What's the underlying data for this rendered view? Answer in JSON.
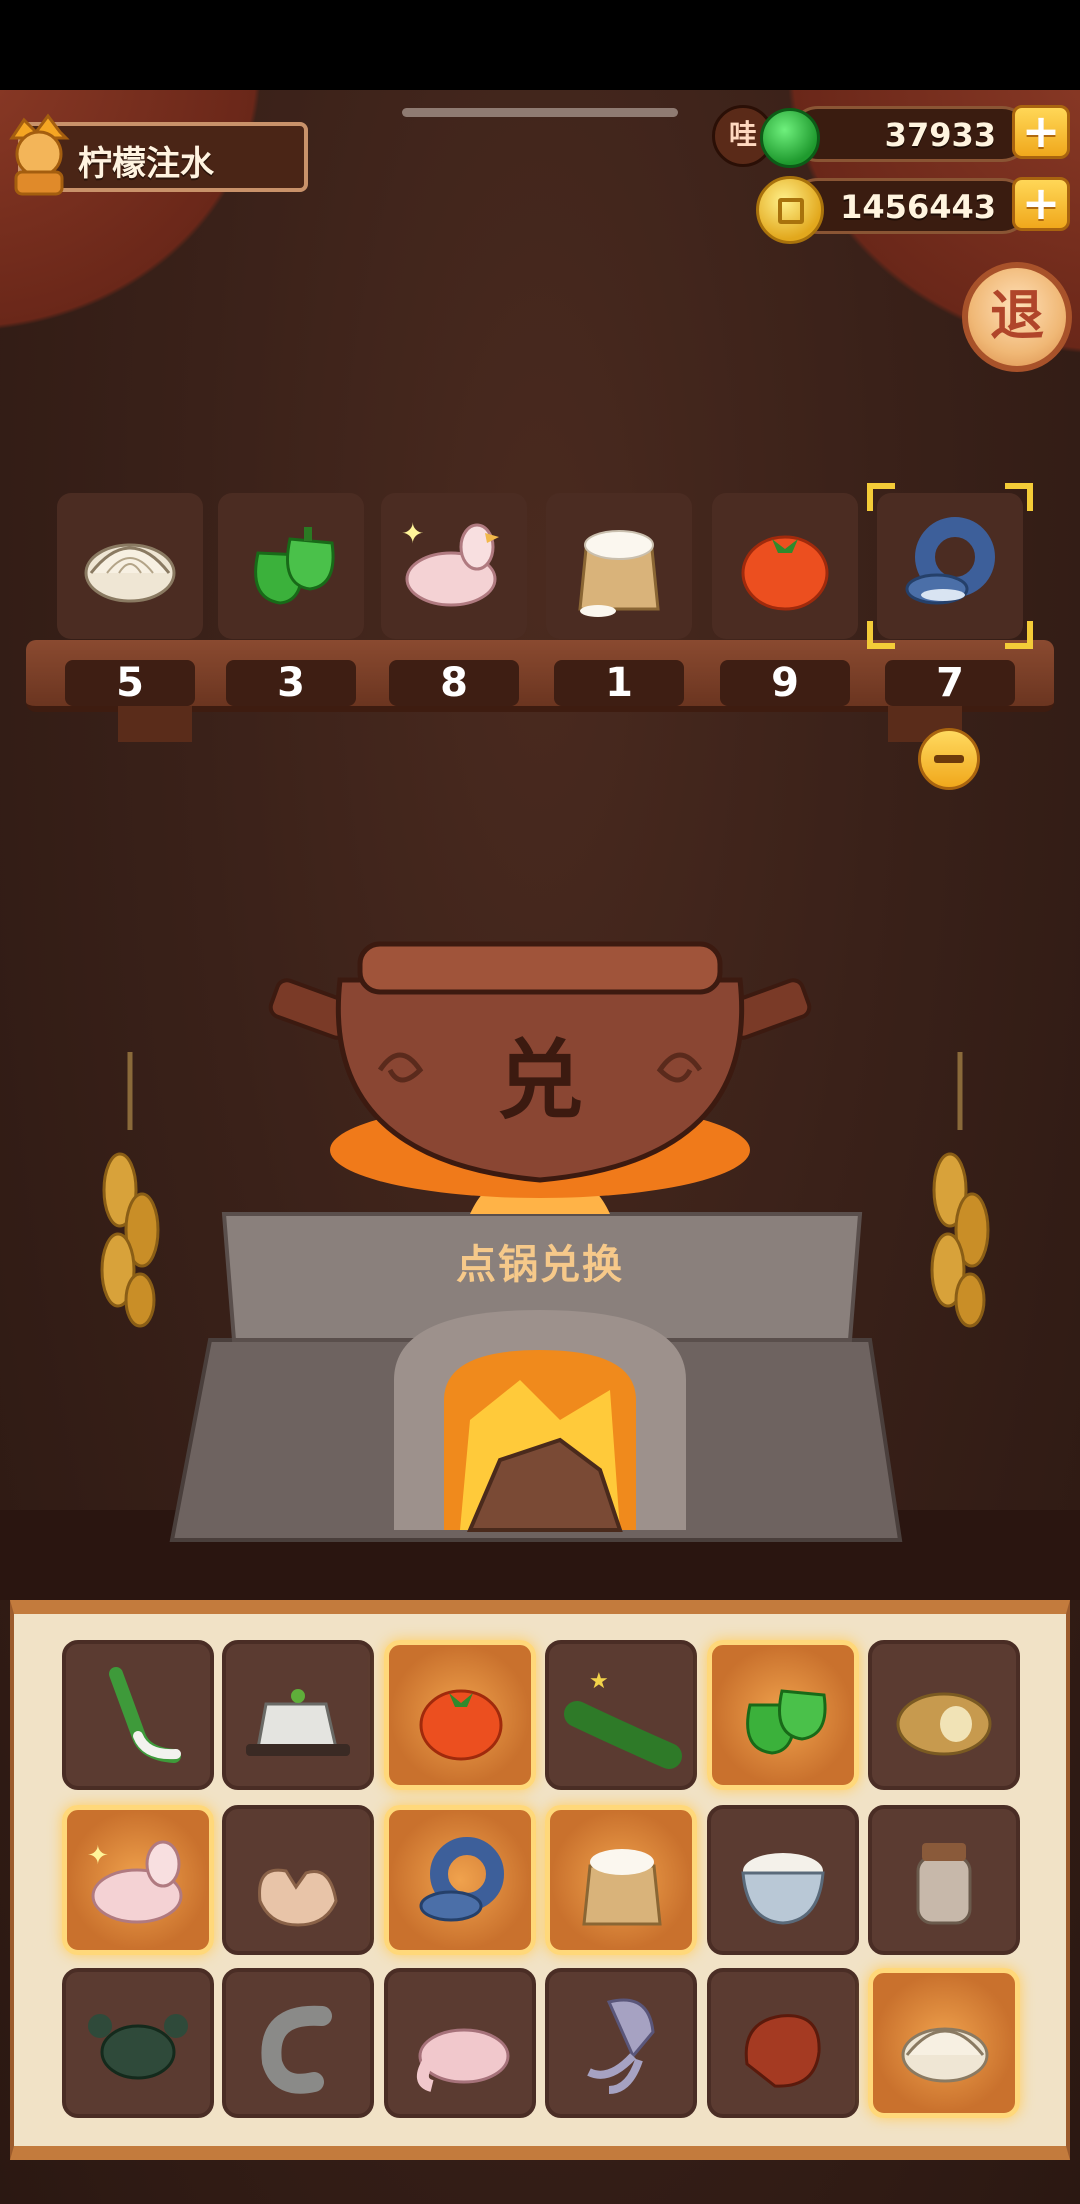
{
  "player": {
    "name": "柠檬注水",
    "avatar_icon": "chef-avatar-icon"
  },
  "currency": {
    "wa_badge": "哇",
    "jade": {
      "icon": "jade-icon",
      "value": "37933"
    },
    "coins": {
      "icon": "coin-icon",
      "value": "1456443"
    },
    "add_label": "+"
  },
  "exit": {
    "label": "退"
  },
  "shelf": [
    {
      "item": "clam",
      "count": "5"
    },
    {
      "item": "green-pepper",
      "count": "3"
    },
    {
      "item": "chicken",
      "count": "8"
    },
    {
      "item": "flour-sack",
      "count": "1"
    },
    {
      "item": "tomato",
      "count": "9"
    },
    {
      "item": "fish",
      "count": "7",
      "selected": true
    }
  ],
  "pot": {
    "character": "兑",
    "action_label": "点锅兑换"
  },
  "inventory": [
    {
      "item": "leek",
      "selected": false
    },
    {
      "item": "tofu",
      "selected": false
    },
    {
      "item": "tomato",
      "selected": true
    },
    {
      "item": "cucumber",
      "selected": false
    },
    {
      "item": "green-pepper",
      "selected": true
    },
    {
      "item": "potato",
      "selected": false
    },
    {
      "item": "chicken",
      "selected": true
    },
    {
      "item": "egg",
      "selected": false
    },
    {
      "item": "fish",
      "selected": true
    },
    {
      "item": "flour-sack",
      "selected": true
    },
    {
      "item": "rice-bowl",
      "selected": false
    },
    {
      "item": "sauce-jar",
      "selected": false
    },
    {
      "item": "crab",
      "selected": false
    },
    {
      "item": "shrimp",
      "selected": false
    },
    {
      "item": "duck",
      "selected": false
    },
    {
      "item": "squid",
      "selected": false
    },
    {
      "item": "meat",
      "selected": false
    },
    {
      "item": "clam",
      "selected": true
    }
  ],
  "colors": {
    "accent": "#f4cc38",
    "panel": "#f1e2c6",
    "slot": "#5b3b31"
  }
}
